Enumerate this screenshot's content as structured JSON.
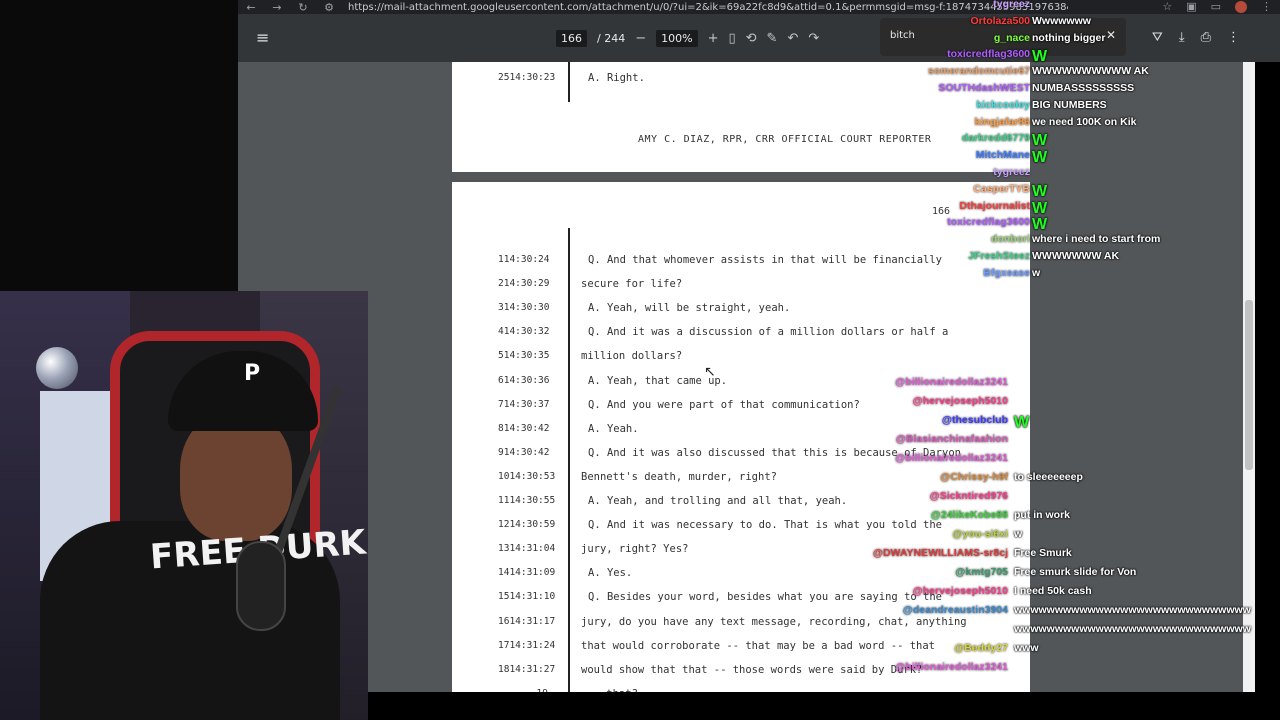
{
  "browser": {
    "url": "https://mail-attachment.googleusercontent.com/attachment/u/0/?ui=2&ik=69a22fc8d9&attid=0.1&permmsgid=msg-f:1874734455985197638&th=1a3... 12e...",
    "avatar_letter": "A"
  },
  "toolbar": {
    "current_page": "166",
    "page_total": "/ 244",
    "zoom": "100%",
    "zoom_out": "−",
    "zoom_in": "+"
  },
  "notification": {
    "text": "bitch",
    "close": "✕"
  },
  "prev_page": {
    "line_num": "25",
    "time": "14:30:23",
    "text": "A.  Right.",
    "reporter": "AMY C. DIAZ, RPR, CRR OFFICIAL COURT REPORTER"
  },
  "page": {
    "page_number": "166",
    "lines": [
      {
        "num": "1",
        "time": "14:30:24",
        "text": "Q.  And that whomever assists in that will be financially",
        "indent": true
      },
      {
        "num": "2",
        "time": "14:30:29",
        "text": "secure for life?",
        "indent": false
      },
      {
        "num": "3",
        "time": "14:30:30",
        "text": "A.  Yeah, will be straight, yeah.",
        "indent": true
      },
      {
        "num": "4",
        "time": "14:30:32",
        "text": "Q.  And it was a discussion of a million dollars or half a",
        "indent": true
      },
      {
        "num": "5",
        "time": "14:30:35",
        "text": "million dollars?",
        "indent": false
      },
      {
        "num": "6",
        "time": "14:30:36",
        "text": "A.  Yeah, that came up.",
        "indent": true
      },
      {
        "num": "7",
        "time": "14:30:37",
        "text": "Q.  And you were part of that communication?",
        "indent": true
      },
      {
        "num": "8",
        "time": "14:30:42",
        "text": "A.  Yeah.",
        "indent": true
      },
      {
        "num": "9",
        "time": "14:30:42",
        "text": "Q.  And it was also discussed that this is because of Daryon",
        "indent": true
      },
      {
        "num": "10",
        "time": "14:30:53",
        "text": "Bennett's death, murder, right?",
        "indent": false
      },
      {
        "num": "11",
        "time": "14:30:55",
        "text": "A.  Yeah, and trolling and all that, yeah.",
        "indent": true
      },
      {
        "num": "12",
        "time": "14:30:59",
        "text": "Q.  And it was necessary to do.  That is what you told the",
        "indent": true
      },
      {
        "num": "13",
        "time": "14:31:04",
        "text": "jury, right?  Yes?",
        "indent": false
      },
      {
        "num": "14",
        "time": "14:31:09",
        "text": "A.  Yes.",
        "indent": true
      },
      {
        "num": "15",
        "time": "14:31:10",
        "text": "Q.  Besides your word, besides what you are saying to the",
        "indent": true
      },
      {
        "num": "16",
        "time": "14:31:17",
        "text": "jury, do you have any text message, recording, chat, anything",
        "indent": false
      },
      {
        "num": "17",
        "time": "14:31:24",
        "text": "that would corroborate -- that may be a bad word -- that",
        "indent": false
      },
      {
        "num": "18",
        "time": "14:31:27",
        "text": "would show that that -- those words were said by Durk?",
        "indent": false
      },
      {
        "num": "19",
        "time": "",
        "text": "... that?",
        "indent": false
      }
    ]
  },
  "chat_top": [
    {
      "user": "tygreez",
      "text": "",
      "color": "#c9a3ff"
    },
    {
      "user": "Ortolaza500",
      "text": "Wwwwwww",
      "color": "#ff3b3b"
    },
    {
      "user": "g_nace",
      "text": "nothing bigger",
      "color": "#7cff3b"
    },
    {
      "user": "toxicredflag3600",
      "text": "W",
      "color": "#b05cff"
    },
    {
      "user": "somerandomcutie67",
      "text": "WWWWWWWWWW AK",
      "color": "#e6a06b"
    },
    {
      "user": "SOUTHdashWEST",
      "text": "NUMBASSSSSSSSS",
      "color": "#b05cff"
    },
    {
      "user": "kickcooley",
      "text": "BIG NUMBERS",
      "color": "#3be0e0"
    },
    {
      "user": "kingjafar86",
      "text": "we need 100K on Kik",
      "color": "#ff9a3b"
    },
    {
      "user": "darkredd6779",
      "text": "W",
      "color": "#3bd18a"
    },
    {
      "user": "MitchMane",
      "text": "W",
      "color": "#3b7bff"
    },
    {
      "user": "tygreez",
      "text": "",
      "color": "#c9a3ff"
    },
    {
      "user": "CasperTYB",
      "text": "W",
      "color": "#ffb07a"
    },
    {
      "user": "Dthajournalist",
      "text": "W",
      "color": "#ff3b3b"
    },
    {
      "user": "toxicredflag3600",
      "text": "W",
      "color": "#b05cff"
    },
    {
      "user": "donbori",
      "text": "where i need to start from",
      "color": "#9ad17a"
    },
    {
      "user": "JFreshSteez",
      "text": "WWWWWWW AK",
      "color": "#3bd18a"
    },
    {
      "user": "Bfgxease",
      "text": "w",
      "color": "#6b9bff"
    }
  ],
  "chat_bottom": [
    {
      "user": "@billionairedollaz3241",
      "text": "",
      "color": "#e25bd6"
    },
    {
      "user": "@hervejoseph5010",
      "text": "",
      "color": "#ff3b8a"
    },
    {
      "user": "@thesubclub",
      "text": "W",
      "color": "#3b3bff"
    },
    {
      "user": "@Blasianchinafaahion",
      "text": "",
      "color": "#d659b8"
    },
    {
      "user": "@billionairedollaz3241",
      "text": "",
      "color": "#e25bd6"
    },
    {
      "user": "@Chrissy-h9f",
      "text": "to sleeeeeeep",
      "color": "#d98a3b"
    },
    {
      "user": "@Sickntired976",
      "text": "",
      "color": "#ff3b8a"
    },
    {
      "user": "@24likeKobe88",
      "text": "put in work",
      "color": "#3bd13b"
    },
    {
      "user": "@you-si6xi",
      "text": "w",
      "color": "#b5d13b"
    },
    {
      "user": "@DWAYNEWILLIAMS-sr8cj",
      "text": "Free Smurk",
      "color": "#e23b3b"
    },
    {
      "user": "@kmtg705",
      "text": "Free smurk slide for Von",
      "color": "#3b9b6b"
    },
    {
      "user": "@hervejoseph5010",
      "text": "I need 50k cash",
      "color": "#ff3b8a"
    },
    {
      "user": "@deandreaustin3904",
      "text": "wwwwwwwwwwwwwwwwwwwwwwwwwwwww",
      "color": "#3b8bd1"
    },
    {
      "user": "",
      "text": "wwwwwwwwwwwwwwwwwwwwwwwwwwwww",
      "color": "#ffffff"
    },
    {
      "user": "@Beddy27",
      "text": "www",
      "color": "#d6d63b"
    },
    {
      "user": "@billionairedollaz3241",
      "text": "",
      "color": "#e25bd6"
    }
  ],
  "webcam": {
    "cap_letter": "P",
    "hoodie_text": "FREE DURK"
  }
}
